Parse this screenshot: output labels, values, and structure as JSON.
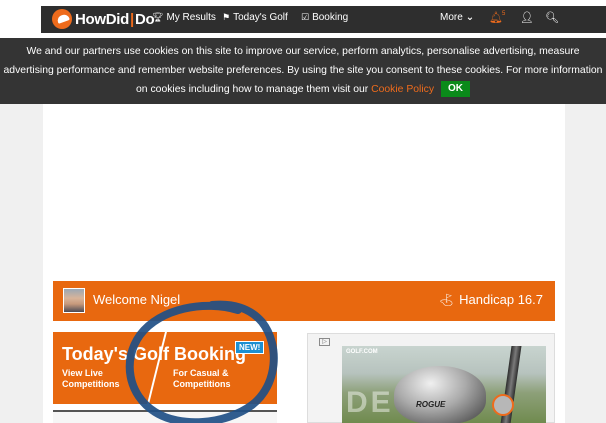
{
  "nav": {
    "logo_how": "HowDid",
    "logo_sep": "|",
    "logo_do": "Do",
    "items": [
      {
        "label": "My Results",
        "icon": "trophy-icon",
        "glyph": "🏆︎"
      },
      {
        "label": "Today's Golf",
        "icon": "flag-icon",
        "glyph": "⚑"
      },
      {
        "label": "Booking",
        "icon": "calendar-check-icon",
        "glyph": "☑"
      }
    ],
    "more_label": "More",
    "more_glyph": "⌄",
    "bell_glyph": "🔔︎",
    "bell_count": "5",
    "user_glyph": "👤︎",
    "search_glyph": "🔍︎"
  },
  "cookie": {
    "text": "We and our partners use cookies on this site to improve our service, perform analytics, personalise advertising, measure advertising performance and remember website preferences. By using the site you consent to these cookies. For more information on cookies including how to manage them visit our",
    "link_label": "Cookie Policy",
    "ok_label": "OK"
  },
  "welcome": {
    "text": "Welcome Nigel",
    "handicap_glyph": "⛳︎",
    "handicap_label": "Handicap 16.7"
  },
  "tiles": {
    "todays_title": "Today's Golf",
    "todays_sub_1": "View Live",
    "todays_sub_2": "Competitions",
    "booking_title": "Booking",
    "booking_sub_1": "For Casual &",
    "booking_sub_2": "Competitions",
    "new_badge": "NEW!",
    "trophy_glyph": "🏆︎"
  },
  "ad": {
    "tag": "▷",
    "brand": "GOLF.COM",
    "ghost_text": "DE TM",
    "club_label": "ROGUE"
  },
  "colors": {
    "accent_orange": "#e8680f",
    "nav_dark": "#2e2e2e",
    "ok_green": "#0a8a1a",
    "annotation_blue": "#1f4f86"
  }
}
